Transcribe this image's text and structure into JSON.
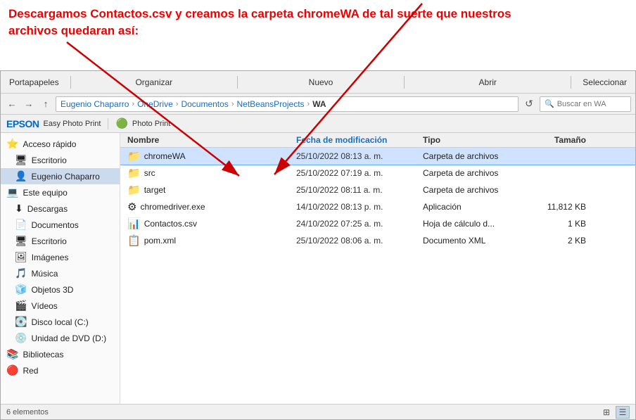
{
  "annotation": {
    "line1": "Descargamos Contactos.csv  y creamos la carpeta chromeWA de tal suerte que nuestros",
    "line2": "archivos quedaran así:"
  },
  "toolbar": {
    "groups": [
      "Portapapeles",
      "Organizar",
      "Nuevo",
      "Abrir",
      "Seleccionar"
    ]
  },
  "navbar": {
    "back": "←",
    "forward": "→",
    "up": "↑",
    "breadcrumb": [
      {
        "label": "Eugenio Chaparro",
        "sep": "›"
      },
      {
        "label": "OneDrive",
        "sep": "›"
      },
      {
        "label": "Documentos",
        "sep": "›"
      },
      {
        "label": "NetBeansProjects",
        "sep": "›"
      },
      {
        "label": "WA",
        "sep": ""
      }
    ],
    "search_placeholder": "Buscar en WA"
  },
  "epson_bar": {
    "logo": "EPSON",
    "label1": "Easy Photo Print",
    "label2": "Photo Print"
  },
  "sidebar": {
    "items": [
      {
        "icon": "⭐",
        "label": "Acceso rápido",
        "active": false,
        "indent": 0
      },
      {
        "icon": "🖥",
        "label": "Escritorio",
        "active": false,
        "indent": 1
      },
      {
        "icon": "👤",
        "label": "Eugenio Chaparro",
        "active": true,
        "indent": 1
      },
      {
        "icon": "💻",
        "label": "Este equipo",
        "active": false,
        "indent": 0
      },
      {
        "icon": "⬇",
        "label": "Descargas",
        "active": false,
        "indent": 1
      },
      {
        "icon": "📄",
        "label": "Documentos",
        "active": false,
        "indent": 1
      },
      {
        "icon": "🖥",
        "label": "Escritorio",
        "active": false,
        "indent": 1
      },
      {
        "icon": "🖼",
        "label": "Imágenes",
        "active": false,
        "indent": 1
      },
      {
        "icon": "🎵",
        "label": "Música",
        "active": false,
        "indent": 1
      },
      {
        "icon": "🧊",
        "label": "Objetos 3D",
        "active": false,
        "indent": 1
      },
      {
        "icon": "🎬",
        "label": "Vídeos",
        "active": false,
        "indent": 1
      },
      {
        "icon": "💽",
        "label": "Disco local (C:)",
        "active": false,
        "indent": 1
      },
      {
        "icon": "💿",
        "label": "Unidad de DVD (D:)",
        "active": false,
        "indent": 1
      },
      {
        "icon": "📚",
        "label": "Bibliotecas",
        "active": false,
        "indent": 0
      },
      {
        "icon": "🔴",
        "label": "Red",
        "active": false,
        "indent": 0
      }
    ]
  },
  "file_list": {
    "headers": {
      "name": "Nombre",
      "date": "Fecha de modificación",
      "type": "Tipo",
      "size": "Tamaño"
    },
    "files": [
      {
        "name": "chromeWA",
        "icon": "📁",
        "color": "#f5a623",
        "date": "25/10/2022 08:13 a. m.",
        "type": "Carpeta de archivos",
        "size": "",
        "selected": true
      },
      {
        "name": "src",
        "icon": "📁",
        "color": "#f5a623",
        "date": "25/10/2022 07:19 a. m.",
        "type": "Carpeta de archivos",
        "size": "",
        "selected": false
      },
      {
        "name": "target",
        "icon": "📁",
        "color": "#f5a623",
        "date": "25/10/2022 08:11 a. m.",
        "type": "Carpeta de archivos",
        "size": "",
        "selected": false
      },
      {
        "name": "chromedriver.exe",
        "icon": "⚙",
        "color": "#555",
        "date": "14/10/2022 08:13 p. m.",
        "type": "Aplicación",
        "size": "11,812 KB",
        "selected": false
      },
      {
        "name": "Contactos.csv",
        "icon": "📊",
        "color": "#1f7f3c",
        "date": "24/10/2022 07:25 a. m.",
        "type": "Hoja de cálculo d...",
        "size": "1 KB",
        "selected": false
      },
      {
        "name": "pom.xml",
        "icon": "📋",
        "color": "#cc4400",
        "date": "25/10/2022 08:06 a. m.",
        "type": "Documento XML",
        "size": "2 KB",
        "selected": false
      }
    ]
  },
  "statusbar": {
    "text": "6 elementos",
    "view_icons": [
      "⊞",
      "☰"
    ]
  }
}
